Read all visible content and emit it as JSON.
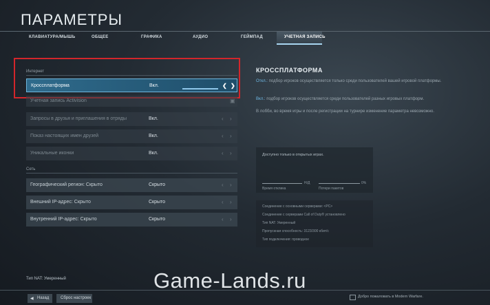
{
  "title": "ПАРАМЕТРЫ",
  "tabs": [
    {
      "label": "КЛАВИАТУРА/МЫШЬ"
    },
    {
      "label": "ОБЩЕЕ"
    },
    {
      "label": "ГРАФИКА"
    },
    {
      "label": "АУДИО"
    },
    {
      "label": "ГЕЙМПАД"
    },
    {
      "label": "УЧЕТНАЯ ЗАПИСЬ"
    }
  ],
  "sections": {
    "internet": "Интернет",
    "network": "Сеть"
  },
  "rows": [
    {
      "label": "Кроссплатформа",
      "value": "Вкл."
    },
    {
      "label": "Учетная запись Activision",
      "value": ""
    },
    {
      "label": "Запросы в друзья и приглашения в отряды",
      "value": "Вкл."
    },
    {
      "label": "Показ настоящих имен друзей",
      "value": "Вкл."
    },
    {
      "label": "Уникальные иконки",
      "value": "Вкл."
    },
    {
      "label": "Географический регион: Скрыто",
      "value": "Скрыто"
    },
    {
      "label": "Внешний IP-адрес: Скрыто",
      "value": "Скрыто"
    },
    {
      "label": "Внутренний IP-адрес: Скрыто",
      "value": "Скрыто"
    }
  ],
  "info": {
    "title": "КРОССПЛАТФОРМА",
    "off_key": "Откл.:",
    "off_text": "подбор игроков осуществляется только среди пользователей вашей игровой платформы.",
    "on_key": "Вкл.:",
    "on_text": "подбор игроков осуществляется среди пользователей разных игровых платформ.",
    "note": "В лобби, во время игры и после регистрации на турнире изменение параметра невозможно."
  },
  "stats": {
    "header": "Доступно только в открытых играх.",
    "latency_value": "Н/Д",
    "latency_label": "Время отклика",
    "packet_value": "0%",
    "packet_label": "Потери пакетов"
  },
  "connection": [
    "Соединение с основными серверами: <PC>",
    "Соединение с серверами Call of Duty® установлено",
    "Тип NAT: Умеренный",
    "Пропускная способность: 3123/300 кбит/с",
    "Тип подключения: проводное"
  ],
  "footer": {
    "nat": "Тип NAT: Умеренный",
    "back": "Назад",
    "reset": "Сброс настроек",
    "welcome": "Добро пожаловать в Modern Warfare.",
    "watermark": "Game-Lands.ru"
  }
}
